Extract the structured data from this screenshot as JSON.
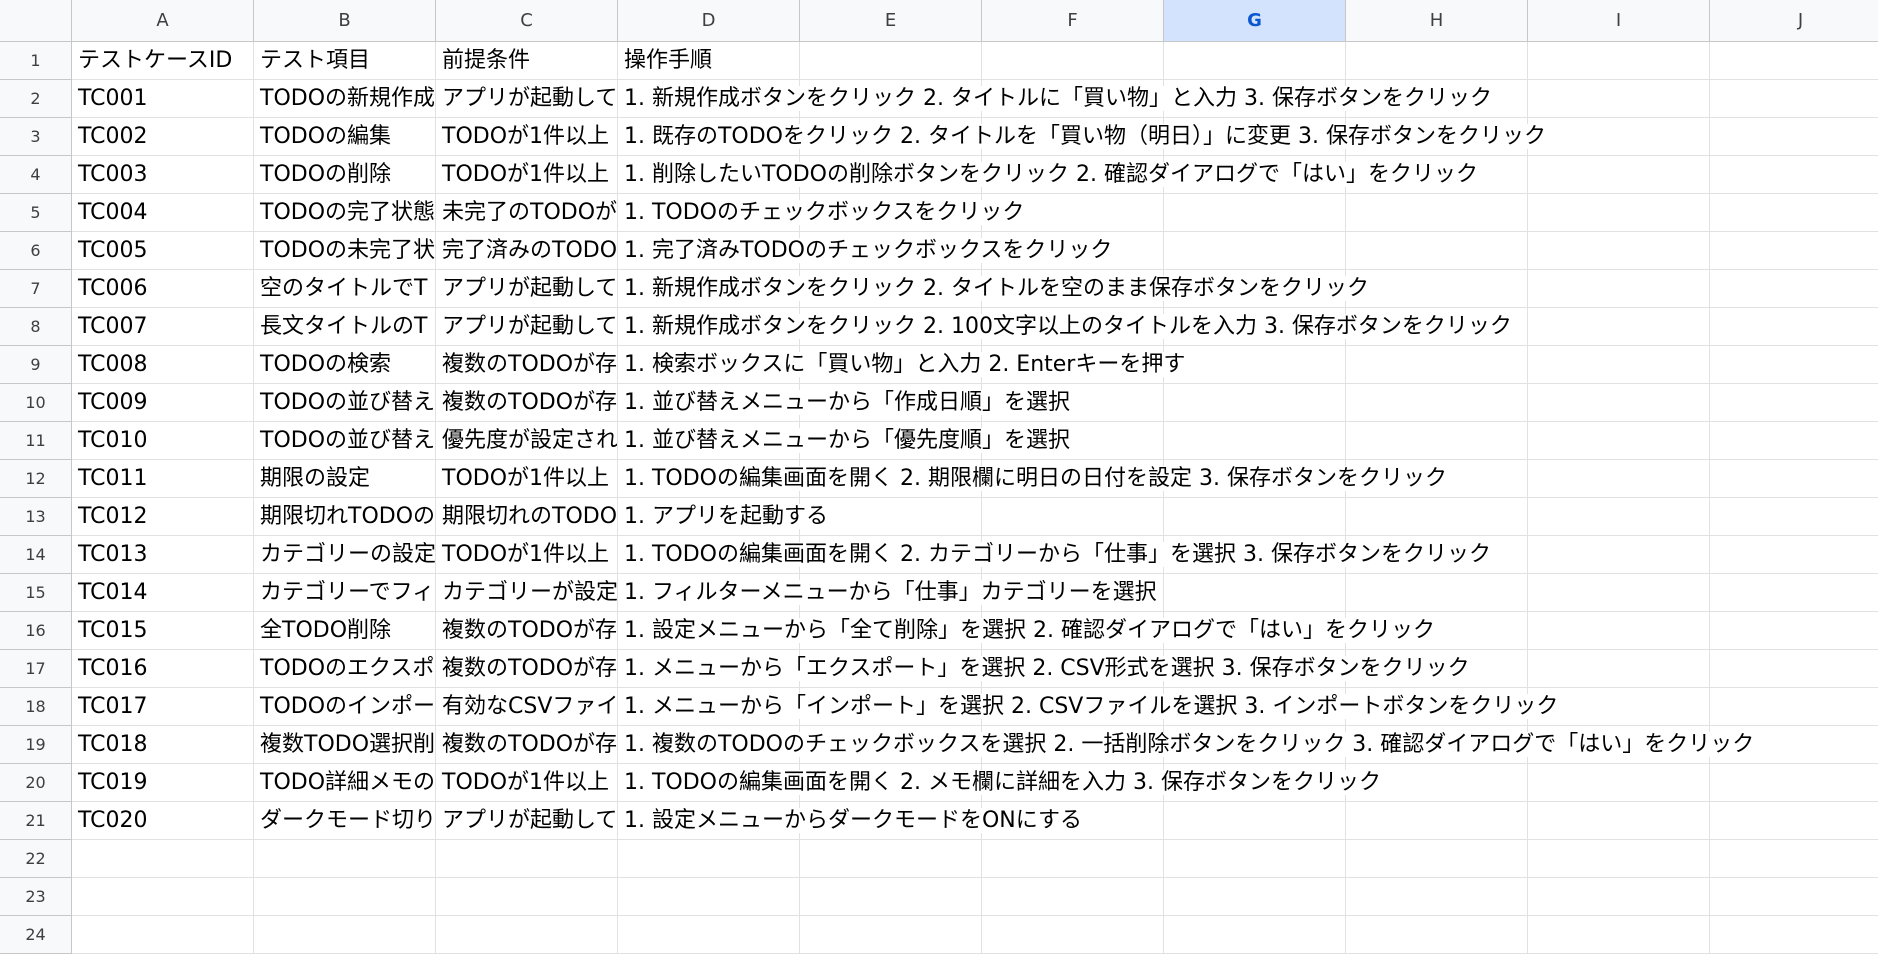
{
  "columns": [
    {
      "label": "A",
      "selected": false
    },
    {
      "label": "B",
      "selected": false
    },
    {
      "label": "C",
      "selected": false
    },
    {
      "label": "D",
      "selected": false
    },
    {
      "label": "E",
      "selected": false
    },
    {
      "label": "F",
      "selected": false
    },
    {
      "label": "G",
      "selected": true
    },
    {
      "label": "H",
      "selected": false
    },
    {
      "label": "I",
      "selected": false
    },
    {
      "label": "J",
      "selected": false
    }
  ],
  "rows": [
    {
      "num": "1",
      "cells": [
        "テストケースID",
        "テスト項目",
        "前提条件",
        "操作手順"
      ]
    },
    {
      "num": "2",
      "cells": [
        "TC001",
        "TODOの新規作成",
        "アプリが起動している",
        "1. 新規作成ボタンをクリック 2. タイトルに「買い物」と入力 3. 保存ボタンをクリック"
      ]
    },
    {
      "num": "3",
      "cells": [
        "TC002",
        "TODOの編集",
        "TODOが1件以上",
        "1. 既存のTODOをクリック 2. タイトルを「買い物（明日）」に変更 3. 保存ボタンをクリック"
      ]
    },
    {
      "num": "4",
      "cells": [
        "TC003",
        "TODOの削除",
        "TODOが1件以上",
        "1. 削除したいTODOの削除ボタンをクリック 2. 確認ダイアログで「はい」をクリック"
      ]
    },
    {
      "num": "5",
      "cells": [
        "TC004",
        "TODOの完了状態",
        "未完了のTODOが",
        "1. TODOのチェックボックスをクリック"
      ]
    },
    {
      "num": "6",
      "cells": [
        "TC005",
        "TODOの未完了状",
        "完了済みのTODO",
        "1. 完了済みTODOのチェックボックスをクリック"
      ]
    },
    {
      "num": "7",
      "cells": [
        "TC006",
        "空のタイトルでT",
        "アプリが起動して",
        "1. 新規作成ボタンをクリック 2. タイトルを空のまま保存ボタンをクリック"
      ]
    },
    {
      "num": "8",
      "cells": [
        "TC007",
        "長文タイトルのT",
        "アプリが起動して",
        "1. 新規作成ボタンをクリック 2. 100文字以上のタイトルを入力 3. 保存ボタンをクリック"
      ]
    },
    {
      "num": "9",
      "cells": [
        "TC008",
        "TODOの検索",
        "複数のTODOが存",
        "1. 検索ボックスに「買い物」と入力 2. Enterキーを押す"
      ]
    },
    {
      "num": "10",
      "cells": [
        "TC009",
        "TODOの並び替え",
        "複数のTODOが存",
        "1. 並び替えメニューから「作成日順」を選択"
      ]
    },
    {
      "num": "11",
      "cells": [
        "TC010",
        "TODOの並び替え",
        "優先度が設定され",
        "1. 並び替えメニューから「優先度順」を選択"
      ]
    },
    {
      "num": "12",
      "cells": [
        "TC011",
        "期限の設定",
        "TODOが1件以上",
        "1. TODOの編集画面を開く 2. 期限欄に明日の日付を設定 3. 保存ボタンをクリック"
      ]
    },
    {
      "num": "13",
      "cells": [
        "TC012",
        "期限切れTODOの",
        "期限切れのTODO",
        "1. アプリを起動する"
      ]
    },
    {
      "num": "14",
      "cells": [
        "TC013",
        "カテゴリーの設定",
        "TODOが1件以上",
        "1. TODOの編集画面を開く 2. カテゴリーから「仕事」を選択 3. 保存ボタンをクリック"
      ]
    },
    {
      "num": "15",
      "cells": [
        "TC014",
        "カテゴリーでフィ",
        "カテゴリーが設定",
        "1. フィルターメニューから「仕事」カテゴリーを選択"
      ]
    },
    {
      "num": "16",
      "cells": [
        "TC015",
        "全TODO削除",
        "複数のTODOが存",
        "1. 設定メニューから「全て削除」を選択 2. 確認ダイアログで「はい」をクリック"
      ]
    },
    {
      "num": "17",
      "cells": [
        "TC016",
        "TODOのエクスポ",
        "複数のTODOが存",
        "1. メニューから「エクスポート」を選択 2. CSV形式を選択 3. 保存ボタンをクリック"
      ]
    },
    {
      "num": "18",
      "cells": [
        "TC017",
        "TODOのインポー",
        "有効なCSVファイ",
        "1. メニューから「インポート」を選択 2. CSVファイルを選択 3. インポートボタンをクリック"
      ]
    },
    {
      "num": "19",
      "cells": [
        "TC018",
        "複数TODO選択削",
        "複数のTODOが存",
        "1. 複数のTODOのチェックボックスを選択 2. 一括削除ボタンをクリック 3. 確認ダイアログで「はい」をクリック"
      ]
    },
    {
      "num": "20",
      "cells": [
        "TC019",
        "TODO詳細メモの",
        "TODOが1件以上",
        "1. TODOの編集画面を開く 2. メモ欄に詳細を入力 3. 保存ボタンをクリック"
      ]
    },
    {
      "num": "21",
      "cells": [
        "TC020",
        "ダークモード切り",
        "アプリが起動して",
        "1. 設定メニューからダークモードをONにする"
      ]
    },
    {
      "num": "22",
      "cells": []
    },
    {
      "num": "23",
      "cells": []
    },
    {
      "num": "24",
      "cells": []
    }
  ]
}
